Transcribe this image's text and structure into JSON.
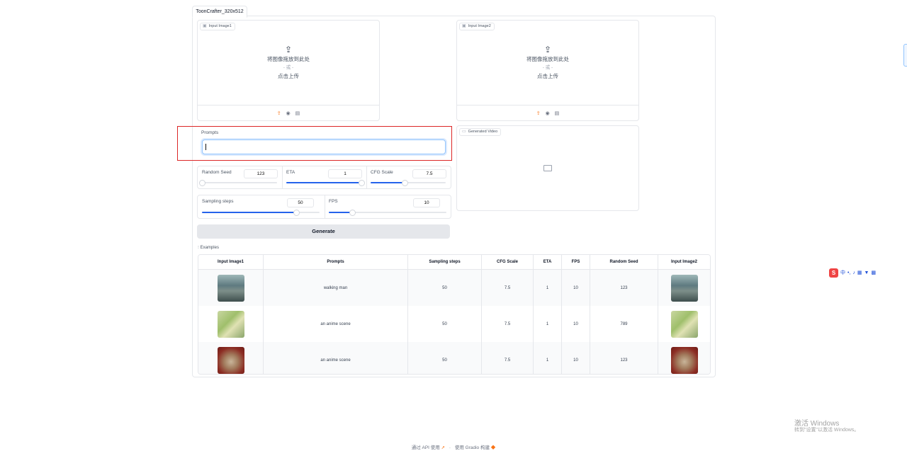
{
  "tab": {
    "label": "ToonCrafter_320x512"
  },
  "input_image1": {
    "label": "Input Image1",
    "drop_line1": "将图像拖放到此处",
    "drop_or": "- 或 -",
    "drop_line2": "点击上传"
  },
  "input_image2": {
    "label": "Input Image2",
    "drop_line1": "将图像拖放到此处",
    "drop_or": "- 或 -",
    "drop_line2": "点击上传"
  },
  "prompts": {
    "label": "Prompts",
    "value": ""
  },
  "generated_video": {
    "label": "Generated Video"
  },
  "sliders": {
    "random_seed": {
      "label": "Random Seed",
      "value": "123",
      "fraction": 0.0
    },
    "eta": {
      "label": "ETA",
      "value": "1",
      "fraction": 1.0
    },
    "cfg_scale": {
      "label": "CFG Scale",
      "value": "7.5",
      "fraction": 0.45
    },
    "sampling_steps": {
      "label": "Sampling steps",
      "value": "50",
      "fraction": 0.8
    },
    "fps": {
      "label": "FPS",
      "value": "10",
      "fraction": 0.2
    }
  },
  "generate_button": {
    "label": "Generate"
  },
  "examples": {
    "label": "Examples",
    "headers": [
      "Input Image1",
      "Prompts",
      "Sampling steps",
      "CFG Scale",
      "ETA",
      "FPS",
      "Random Seed",
      "Input Image2"
    ],
    "rows": [
      {
        "prompt": "walking man",
        "steps": "50",
        "cfg": "7.5",
        "eta": "1",
        "fps": "10",
        "seed": "123"
      },
      {
        "prompt": "an anime scene",
        "steps": "50",
        "cfg": "7.5",
        "eta": "1",
        "fps": "10",
        "seed": "789"
      },
      {
        "prompt": "an anime scene",
        "steps": "50",
        "cfg": "7.5",
        "eta": "1",
        "fps": "10",
        "seed": "123"
      }
    ]
  },
  "footer": {
    "api_text": "通过 API 使用",
    "sep": "·",
    "built_text": "使用 Gradio 构建"
  },
  "watermark": {
    "line1": "激活 Windows",
    "line2": "转到\"设置\"以激活 Windows。"
  },
  "ime": {
    "logo": "S",
    "lang": "中"
  },
  "colors": {
    "accent": "#2563eb",
    "upload_icon": "#f97316",
    "highlight_frame": "#dc2626"
  }
}
